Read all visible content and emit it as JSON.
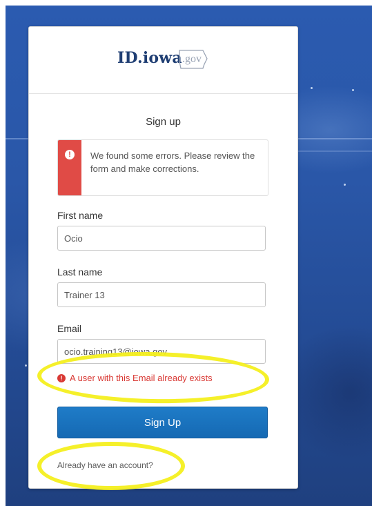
{
  "brand": {
    "logo_main": "ID.iowa",
    "logo_suffix": ".gov"
  },
  "form": {
    "heading": "Sign up",
    "alert_message": "We found some errors. Please review the form and make corrections.",
    "first_name_label": "First name",
    "first_name_value": "Ocio",
    "last_name_label": "Last name",
    "last_name_value": "Trainer 13",
    "email_label": "Email",
    "email_value": "ocio.training13@iowa.gov",
    "email_error": "A user with this Email already exists",
    "submit_label": "Sign Up",
    "account_link": "Already have an account?"
  },
  "icons": {
    "alert": "exclamation-circle-icon",
    "field_error": "exclamation-circle-icon"
  },
  "colors": {
    "error": "#d93934",
    "button": "#1569b3",
    "highlight": "#f4ef1f"
  }
}
